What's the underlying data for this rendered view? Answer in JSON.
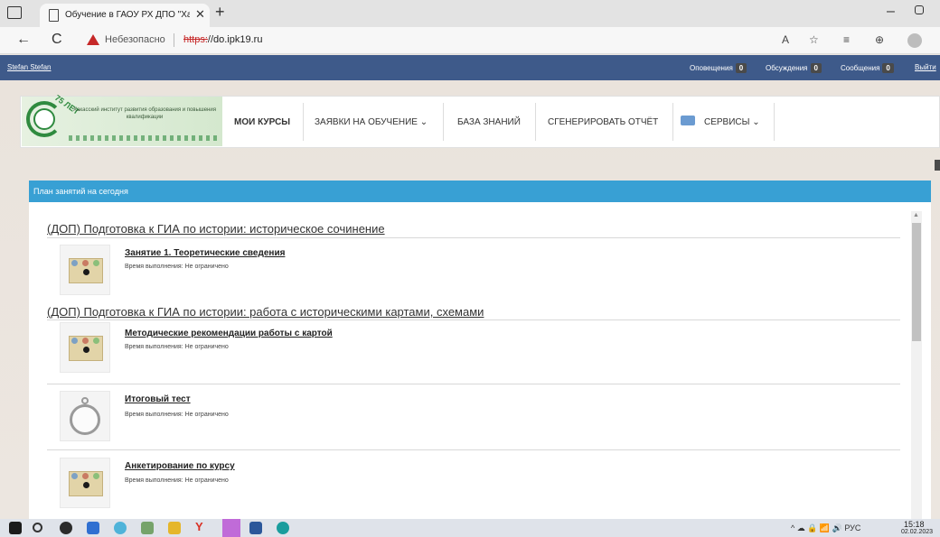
{
  "browser": {
    "tab_title": "Обучение в ГАОУ РХ ДПО \"Хака",
    "new_tab_symbol": "+",
    "close_symbol": "✕",
    "back_symbol": "←",
    "reload_symbol": "C",
    "security_warning": "Небезопасно",
    "url_scheme": "https:",
    "url_rest": "//do.ipk19.ru",
    "minimize_symbol": "–",
    "toolbar_icons": [
      "read-aloud-icon",
      "favorites-add-icon",
      "favorites-icon",
      "collections-icon",
      "profile-icon"
    ]
  },
  "topbar": {
    "user": "Stefan Stefan",
    "notifications": {
      "label": "Оповещения",
      "count": "0"
    },
    "discussions": {
      "label": "Обсуждения",
      "count": "0"
    },
    "messages": {
      "label": "Сообщения",
      "count": "0"
    },
    "logout": "Выйти"
  },
  "logo": {
    "anniversary": "75 ЛЕТ",
    "text": "Хакасский институт развития образования и повышения квалификации"
  },
  "nav": {
    "my_courses": "МОИ КУРСЫ",
    "applications": "ЗАЯВКИ НА ОБУЧЕНИЕ ⌄",
    "knowledge_base": "БАЗА ЗНАНИЙ",
    "generate_report": "СГЕНЕРИРОВАТЬ ОТЧЁТ",
    "services": "СЕРВИСЫ ⌄"
  },
  "panel": {
    "title": "План занятий на сегодня"
  },
  "courses": [
    {
      "title": "(ДОП) Подготовка к ГИА по истории: историческое сочинение",
      "lessons": [
        {
          "title": "Занятие 1. Теоретические сведения",
          "meta": "Время выполнения: Не ограничено",
          "icon": "lesson-board-icon"
        }
      ]
    },
    {
      "title": "(ДОП) Подготовка к ГИА по истории: работа с историческими картами, схемами",
      "lessons": [
        {
          "title": "Методические рекомендации работы с картой",
          "meta": "Время выполнения: Не ограничено",
          "icon": "lesson-board-icon"
        },
        {
          "title": "Итоговый тест",
          "meta": "Время выполнения: Не ограничено",
          "icon": "stopwatch-icon"
        },
        {
          "title": "Анкетирование по курсу",
          "meta": "Время выполнения: Не ограничено",
          "icon": "lesson-board-icon"
        }
      ]
    }
  ],
  "taskbar": {
    "tray_text": "^ ☁ 🔒 📶 🔊 РУС",
    "time": "15:18",
    "date": "02.02.2023"
  }
}
